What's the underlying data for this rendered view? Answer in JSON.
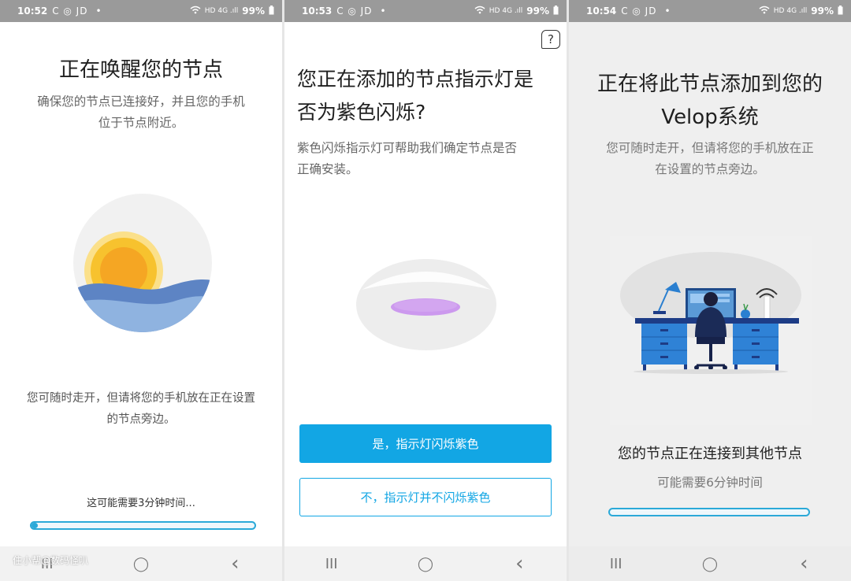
{
  "screens": [
    {
      "status": {
        "time": "10:52",
        "icons": "C ◎ JD",
        "dot": "•",
        "signal": "HD 4G .ıll",
        "battery": "99%"
      },
      "title": "正在唤醒您的节点",
      "subtitle_line1": "确保您的节点已连接好，并且您的手机",
      "subtitle_line2": "位于节点附近。",
      "hint_line1": "您可随时走开，但请将您的手机放在正在设置",
      "hint_line2": "的节点旁边。",
      "status_text": "这可能需要3分钟时间...",
      "progress": 0.03,
      "watermark": "住小帮@数码怪叭",
      "illustration": "sunrise-icon"
    },
    {
      "status": {
        "time": "10:53",
        "icons": "C ◎ JD",
        "dot": "•",
        "signal": "HD 4G .ıll",
        "battery": "99%"
      },
      "help_icon": "?",
      "title_line1": "您正在添加的节点指示灯是",
      "title_line2": "否为紫色闪烁?",
      "subtitle_line1": "紫色闪烁指示灯可帮助我们确定节点是否",
      "subtitle_line2": "正确安装。",
      "yes_button": "是，指示灯闪烁紫色",
      "no_button": "不，指示灯并不闪烁紫色",
      "illustration": "node-light-icon"
    },
    {
      "status": {
        "time": "10:54",
        "icons": "C ◎ JD",
        "dot": "•",
        "signal": "HD 4G .ıll",
        "battery": "99%"
      },
      "title_line1": "正在将此节点添加到您的",
      "title_line2": "Velop系统",
      "subtitle_line1": "您可随时走开，但请将您的手机放在正",
      "subtitle_line2": "在设置的节点旁边。",
      "connecting_text": "您的节点正在连接到其他节点",
      "time_text": "可能需要6分钟时间",
      "progress": 0.0,
      "illustration": "workspace-icon"
    }
  ],
  "nav": {
    "recents": "III",
    "home": "◯",
    "back": "‹"
  },
  "colors": {
    "accent": "#12a6e4",
    "purple": "#cc99ee",
    "sun": "#f7c22e"
  }
}
